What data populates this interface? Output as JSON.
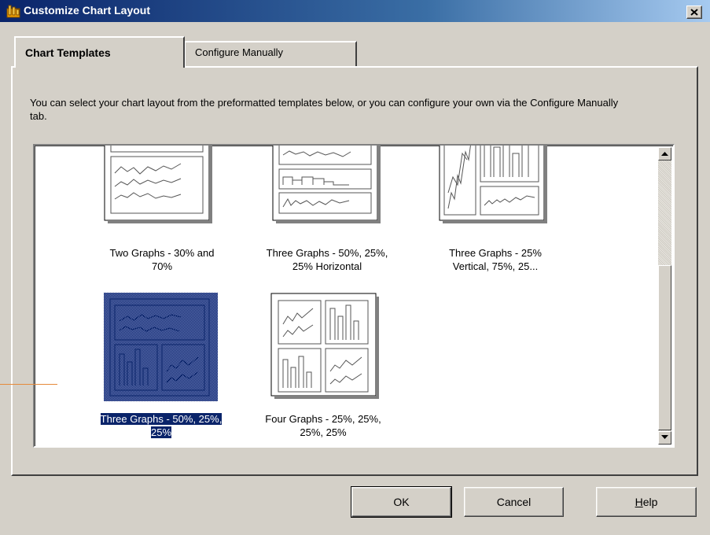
{
  "window": {
    "title": "Customize Chart Layout"
  },
  "tabs": [
    {
      "label": "Chart Templates",
      "active": true
    },
    {
      "label": "Configure Manually",
      "active": false
    }
  ],
  "intro_text": "You can select your chart layout from the preformatted templates below, or you can configure your own via the Configure Manually tab.",
  "templates": [
    {
      "label_line1": "Two Graphs - 30% and",
      "label_line2": "70%",
      "selected": false
    },
    {
      "label_line1": "Three Graphs - 50%, 25%,",
      "label_line2": "25% Horizontal",
      "selected": false
    },
    {
      "label_line1": "Three Graphs - 25%",
      "label_line2": "Vertical, 75%, 25...",
      "selected": false
    },
    {
      "label_line1": "Three Graphs - 50%, 25%,",
      "label_line2": "25%",
      "selected": true
    },
    {
      "label_line1": "Four Graphs - 25%, 25%,",
      "label_line2": "25%, 25%",
      "selected": false
    }
  ],
  "buttons": {
    "ok": "OK",
    "cancel": "Cancel",
    "help_underlined": "H",
    "help_rest": "elp"
  },
  "colors": {
    "selection": "#0a246a",
    "face": "#d4d0c8",
    "titlebar_start": "#0a246a"
  }
}
